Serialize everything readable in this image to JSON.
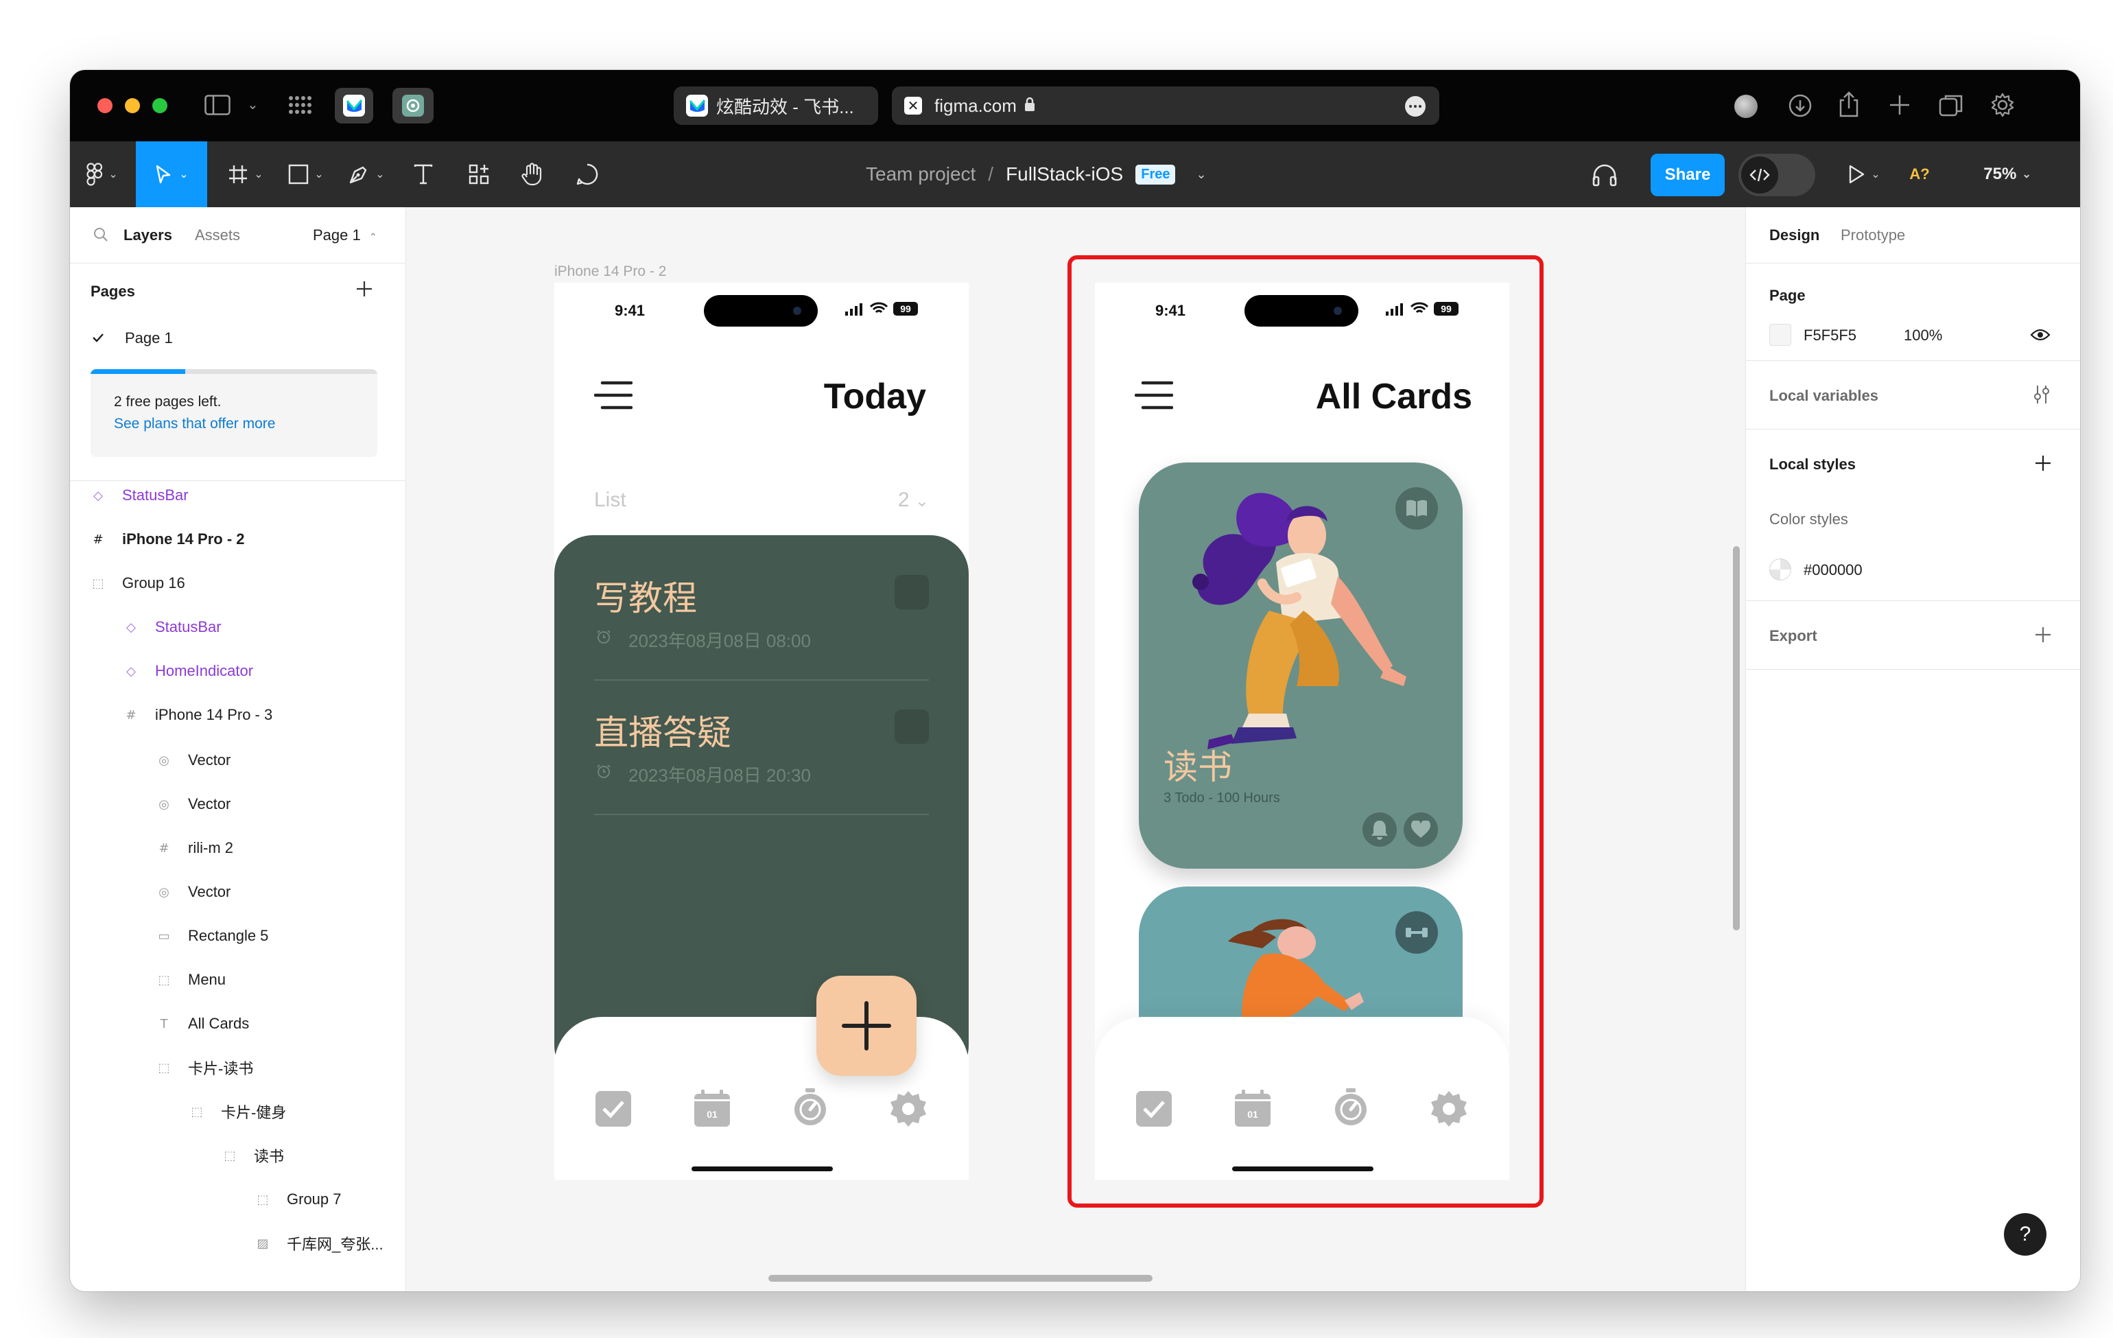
{
  "browser": {
    "tab1_title": "炫酷动效 - 飞书...",
    "address": "figma.com"
  },
  "toolbar": {
    "breadcrumb_team": "Team project",
    "separator": "/",
    "file_name": "FullStack-iOS",
    "plan_badge": "Free",
    "share_label": "Share",
    "ai_label": "A?",
    "zoom": "75%",
    "accent": "#0d99ff"
  },
  "left": {
    "tab_layers": "Layers",
    "tab_assets": "Assets",
    "page_selector": "Page 1",
    "pages_title": "Pages",
    "current_page": "Page 1",
    "upsell_text": "2 free pages left.",
    "upsell_link": "See plans that offer more",
    "layers": [
      {
        "name": "StatusBar",
        "icon": "component-icon"
      },
      {
        "name": "iPhone 14 Pro - 2",
        "icon": "frame-icon"
      },
      {
        "name": "Group 16",
        "icon": "group-icon"
      },
      {
        "name": "StatusBar",
        "icon": "component-icon"
      },
      {
        "name": "HomeIndicator",
        "icon": "component-icon"
      },
      {
        "name": "iPhone 14 Pro - 3",
        "icon": "frame-icon"
      },
      {
        "name": "Vector",
        "icon": "vector-icon"
      },
      {
        "name": "Vector",
        "icon": "vector-icon"
      },
      {
        "name": "rili-m 2",
        "icon": "frame-icon"
      },
      {
        "name": "Vector",
        "icon": "vector-icon"
      },
      {
        "name": "Rectangle 5",
        "icon": "rectangle-icon"
      },
      {
        "name": "Menu",
        "icon": "group-icon"
      },
      {
        "name": "All Cards",
        "icon": "text-icon"
      },
      {
        "name": "卡片-读书",
        "icon": "group-icon"
      },
      {
        "name": "卡片-健身",
        "icon": "group-icon"
      },
      {
        "name": "读书",
        "icon": "group-icon"
      },
      {
        "name": "Group 7",
        "icon": "group-icon"
      },
      {
        "name": "千库网_夸张...",
        "icon": "image-icon"
      }
    ]
  },
  "canvas": {
    "frame_label": "iPhone 14 Pro - 2",
    "phone1": {
      "time": "9:41",
      "battery": "99",
      "title": "Today",
      "list_label": "List",
      "list_count": "2",
      "tasks": [
        {
          "title": "写教程",
          "time": "2023年08月08日 08:00"
        },
        {
          "title": "直播答疑",
          "time": "2023年08月08日 20:30"
        }
      ],
      "calendar_day": "01",
      "card_color": "#44594f",
      "task_text_color": "#f3c8a0"
    },
    "phone2": {
      "time": "9:41",
      "battery": "99",
      "title": "All Cards",
      "card1_title": "读书",
      "card1_sub": "3 Todo - 100 Hours",
      "calendar_day": "01",
      "card1_color": "#6b9088",
      "card2_color": "#6ba6ab"
    },
    "selection_color": "#e8171b"
  },
  "right": {
    "tab_design": "Design",
    "tab_prototype": "Prototype",
    "page_title": "Page",
    "page_color": "F5F5F5",
    "page_opacity": "100%",
    "local_variables": "Local variables",
    "local_styles": "Local styles",
    "color_styles": "Color styles",
    "color_style_value": "#000000",
    "export": "Export",
    "help": "?"
  }
}
